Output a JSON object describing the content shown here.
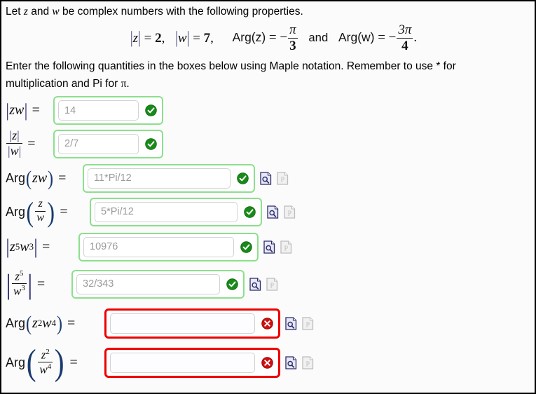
{
  "problem": {
    "intro_prefix": "Let ",
    "intro_var1": "z",
    "intro_mid": " and ",
    "intro_var2": "w",
    "intro_suffix": " be complex numbers with the following properties.",
    "given": {
      "mod_z_label": "|z|",
      "mod_z_value": "2",
      "mod_w_label": "|w|",
      "mod_w_value": "7",
      "arg_z_label": "Arg(z)",
      "arg_z_value": "-π/3",
      "arg_z_num": "π",
      "arg_z_den": "3",
      "conjunction": "and",
      "arg_w_label": "Arg(w)",
      "arg_w_value": "-3π/4",
      "arg_w_num": "3π",
      "arg_w_den": "4",
      "comma": ",",
      "period": ".",
      "minus": "−",
      "equals": "="
    },
    "instructions_line1": "Enter the following quantities in the boxes below using Maple notation.  Remember to use * for",
    "instructions_line2_a": "multiplication and Pi for ",
    "instructions_line2_pi": "π",
    "instructions_line2_b": "."
  },
  "symbols": {
    "equals": "=",
    "abs_bar": "|",
    "paren_open": "(",
    "paren_close": ")",
    "arg": "Arg",
    "z": "z",
    "w": "w"
  },
  "answers": [
    {
      "id": "mod-zw",
      "label_text": "|zw| =",
      "value": "14",
      "status": "correct",
      "status_icon": "check-circle-icon",
      "input_width": 115,
      "has_tools": false
    },
    {
      "id": "mod-z-over-w",
      "label_text": "|z|/|w| =",
      "value": "2/7",
      "status": "correct",
      "status_icon": "check-circle-icon",
      "input_width": 115,
      "has_tools": false
    },
    {
      "id": "arg-zw",
      "label_text": "Arg(zw) =",
      "value": "11*Pi/12",
      "status": "correct",
      "status_icon": "check-circle-icon",
      "input_width": 204,
      "has_tools": true
    },
    {
      "id": "arg-z-over-w",
      "label_text": "Arg(z/w) =",
      "value": "5*Pi/12",
      "status": "correct",
      "status_icon": "check-circle-icon",
      "input_width": 204,
      "has_tools": true
    },
    {
      "id": "mod-z5-w3",
      "label_text": "|z^5 w^3| =",
      "value": "10976",
      "status": "correct",
      "status_icon": "check-circle-icon",
      "input_width": 215,
      "has_tools": true
    },
    {
      "id": "mod-z5-over-w3",
      "label_text": "|z^5/w^3| =",
      "value": "32/343",
      "status": "correct",
      "status_icon": "check-circle-icon",
      "input_width": 205,
      "has_tools": true
    },
    {
      "id": "arg-z2-w4",
      "label_text": "Arg(z^2 w^4) =",
      "value": "",
      "status": "incorrect",
      "status_icon": "error-circle-icon",
      "input_width": 207,
      "has_tools": true
    },
    {
      "id": "arg-z2-over-w4",
      "label_text": "Arg(z^2/w^4) =",
      "value": "",
      "status": "incorrect",
      "status_icon": "error-circle-icon",
      "input_width": 207,
      "has_tools": true
    }
  ],
  "exponents": {
    "five": "5",
    "three": "3",
    "two": "2",
    "four": "4"
  },
  "tools": {
    "preview_icon": "preview-magnifier-page-icon",
    "render_icon": "render-page-p-icon"
  },
  "colors": {
    "correct_border": "#8ce08c",
    "incorrect_border": "#ee0000",
    "check_green": "#1f8a1f",
    "error_red": "#cc0000",
    "math_accent": "#3b3b7a",
    "page_background": "#fbfbfb",
    "page_border": "#000000"
  }
}
